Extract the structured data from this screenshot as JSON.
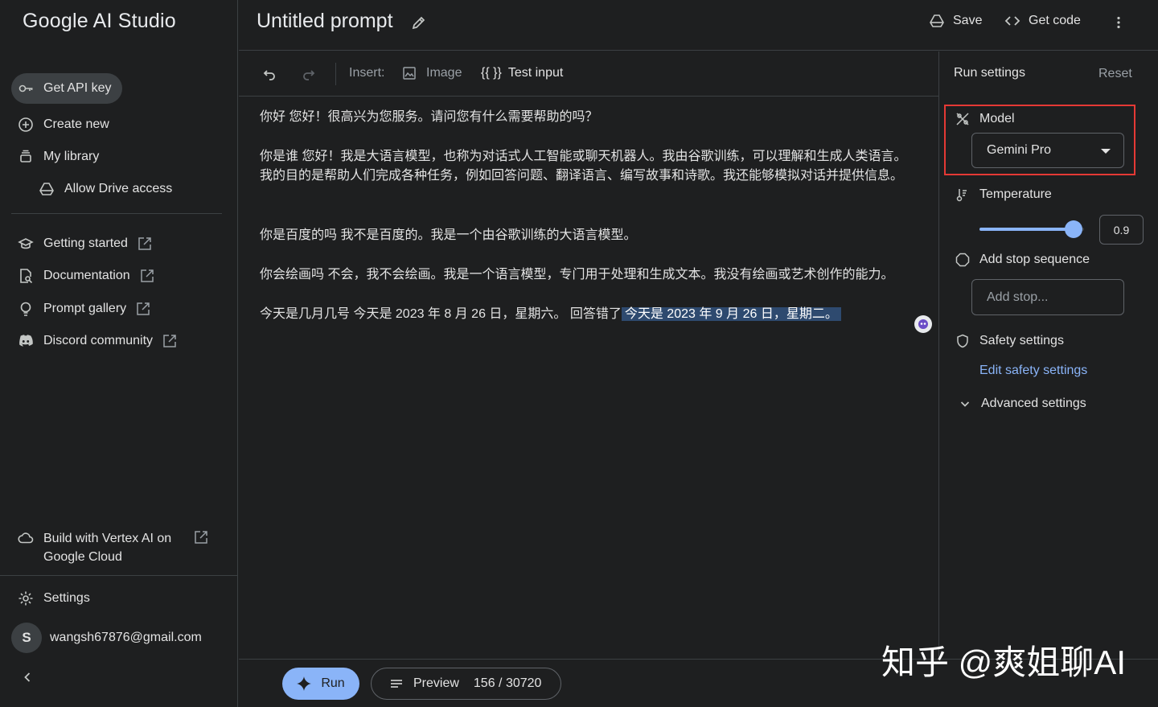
{
  "sidebar": {
    "logo": "Google AI Studio",
    "get_api_key": "Get API key",
    "create_new": "Create new",
    "my_library": "My library",
    "allow_drive": "Allow Drive access",
    "getting_started": "Getting started",
    "documentation": "Documentation",
    "prompt_gallery": "Prompt gallery",
    "discord": "Discord community",
    "vertex_line1": "Build with Vertex AI on",
    "vertex_line2": "Google Cloud",
    "settings": "Settings",
    "avatar_letter": "S",
    "email": "wangsh67876@gmail.com"
  },
  "header": {
    "title": "Untitled prompt",
    "save": "Save",
    "get_code": "Get code"
  },
  "toolbar": {
    "insert_label": "Insert:",
    "image": "Image",
    "test_input_glyph": "{{ }}",
    "test_input": "Test input"
  },
  "editor": {
    "line1": "你好 您好！很高兴为您服务。请问您有什么需要帮助的吗？",
    "line2": "你是谁 您好！我是大语言模型，也称为对话式人工智能或聊天机器人。我由谷歌训练，可以理解和生成人类语言。",
    "line3": "我的目的是帮助人们完成各种任务，例如回答问题、翻译语言、编写故事和诗歌。我还能够模拟对话并提供信息。",
    "line4": "你是百度的吗 我不是百度的。我是一个由谷歌训练的大语言模型。",
    "line5": "你会绘画吗 不会，我不会绘画。我是一个语言模型，专门用于处理和生成文本。我没有绘画或艺术创作的能力。",
    "line6_prefix": "今天是几月几号 今天是 2023 年 8 月 26 日，星期六。 回答错了",
    "line6_highlight": "今天是 2023 年 9 月 26 日，星期二。"
  },
  "bottom": {
    "run": "Run",
    "preview": "Preview",
    "token_count": "156 / 30720",
    "watermark": "知乎 @爽姐聊AI"
  },
  "run_settings": {
    "title": "Run settings",
    "reset": "Reset",
    "model_label": "Model",
    "model_value": "Gemini Pro",
    "temperature_label": "Temperature",
    "temperature_value": "0.9",
    "temperature_fraction": 0.9,
    "stop_label": "Add stop sequence",
    "stop_placeholder": "Add stop...",
    "safety_label": "Safety settings",
    "safety_link": "Edit safety settings",
    "advanced_label": "Advanced settings"
  },
  "colors": {
    "background": "#1e1f20",
    "accent": "#8ab4f8",
    "highlight": "#2e4a6f",
    "model_outline": "#e53935"
  }
}
